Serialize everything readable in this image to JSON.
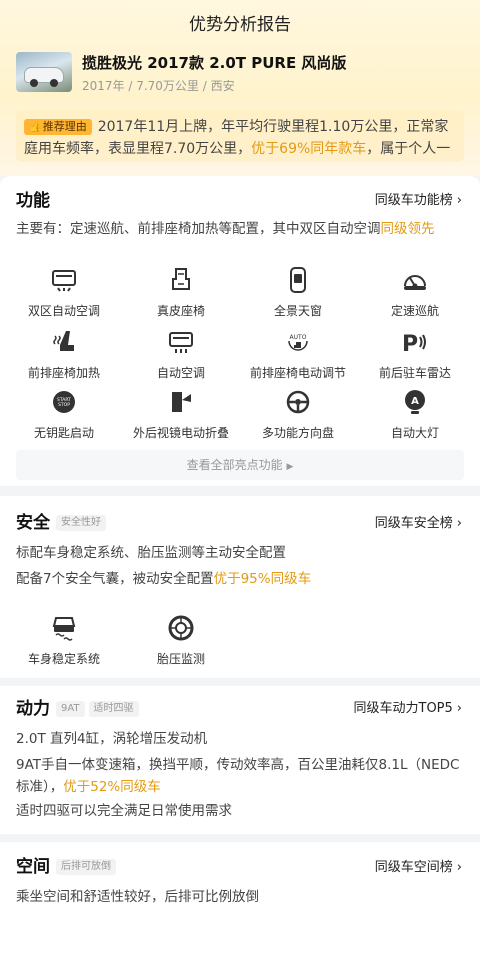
{
  "page": {
    "title": "优势分析报告"
  },
  "car": {
    "name": "揽胜极光 2017款 2.0T PURE 风尚版",
    "meta": "2017年 / 7.70万公里 / 西安"
  },
  "recommend": {
    "tag": "推荐理由",
    "text_1": "2017年11月上牌，年平均行驶里程1.10万公里，正常家庭用车频率，表显里程7.70万公里，",
    "highlight": "优于69%同年款车",
    "text_2": "，属于个人一手好车"
  },
  "features": {
    "title": "功能",
    "rank_label": "同级车功能榜",
    "summary": "主要有：定速巡航、前排座椅加热等配置，其中双区自动空调",
    "summary_hl": "同级领先",
    "items": [
      {
        "label": "双区自动空调",
        "icon": "dual-zone-ac-icon"
      },
      {
        "label": "真皮座椅",
        "icon": "leather-seat-icon"
      },
      {
        "label": "全景天窗",
        "icon": "panoramic-sunroof-icon"
      },
      {
        "label": "定速巡航",
        "icon": "cruise-control-icon"
      },
      {
        "label": "前排座椅加热",
        "icon": "seat-heating-icon"
      },
      {
        "label": "自动空调",
        "icon": "auto-ac-icon"
      },
      {
        "label": "前排座椅电动调节",
        "icon": "power-seat-icon"
      },
      {
        "label": "前后驻车雷达",
        "icon": "parking-radar-icon"
      },
      {
        "label": "无钥匙启动",
        "icon": "keyless-start-icon"
      },
      {
        "label": "外后视镜电动折叠",
        "icon": "mirror-fold-icon"
      },
      {
        "label": "多功能方向盘",
        "icon": "steering-wheel-icon"
      },
      {
        "label": "自动大灯",
        "icon": "auto-headlight-icon"
      }
    ],
    "more_label": "查看全部亮点功能"
  },
  "safety": {
    "title": "安全",
    "tag": "安全性好",
    "rank_label": "同级车安全榜",
    "line_1": "标配车身稳定系统、胎压监测等主动安全配置",
    "line_2_text": "配备7个安全气囊，被动安全配置",
    "line_2_hl": "优于95%同级车",
    "items": [
      {
        "label": "车身稳定系统",
        "icon": "stability-control-icon"
      },
      {
        "label": "胎压监测",
        "icon": "tire-pressure-icon"
      }
    ]
  },
  "power": {
    "title": "动力",
    "tags": [
      "9AT",
      "适时四驱"
    ],
    "rank_label": "同级车动力TOP5",
    "line_1": "2.0T 直列4缸，涡轮增压发动机",
    "line_2_text": "9AT手自一体变速箱，换挡平顺，传动效率高，百公里油耗仅8.1L（NEDC标准），",
    "line_2_hl": "优于52%同级车",
    "line_3": "适时四驱可以完全满足日常使用需求"
  },
  "space": {
    "title": "空间",
    "tag": "后排可放倒",
    "rank_label": "同级车空间榜",
    "line_1": "乘坐空间和舒适性较好，后排可比例放倒"
  },
  "colors": {
    "accent": "#e39a14",
    "tag_bg": "#ffb733",
    "header_bg": "#fff3cd"
  }
}
